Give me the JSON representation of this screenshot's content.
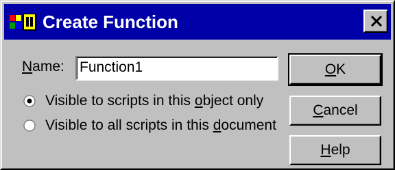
{
  "window": {
    "title": "Create Function",
    "icon": "app-icon",
    "close_icon": "close-icon"
  },
  "form": {
    "name_label_mnemonic": "N",
    "name_label_rest": "ame:",
    "name_value": "Function1",
    "options": [
      {
        "pre": "Visible to scripts in this ",
        "mnemonic": "o",
        "post": "bject only",
        "selected": true
      },
      {
        "pre": "Visible to all scripts in this ",
        "mnemonic": "d",
        "post": "ocument",
        "selected": false
      }
    ]
  },
  "buttons": {
    "ok_mnemonic": "O",
    "ok_rest": "K",
    "cancel_mnemonic": "C",
    "cancel_rest": "ancel",
    "help_mnemonic": "H",
    "help_rest": "elp"
  },
  "colors": {
    "titlebar": "#0000a8",
    "face": "#c0c0c0"
  }
}
